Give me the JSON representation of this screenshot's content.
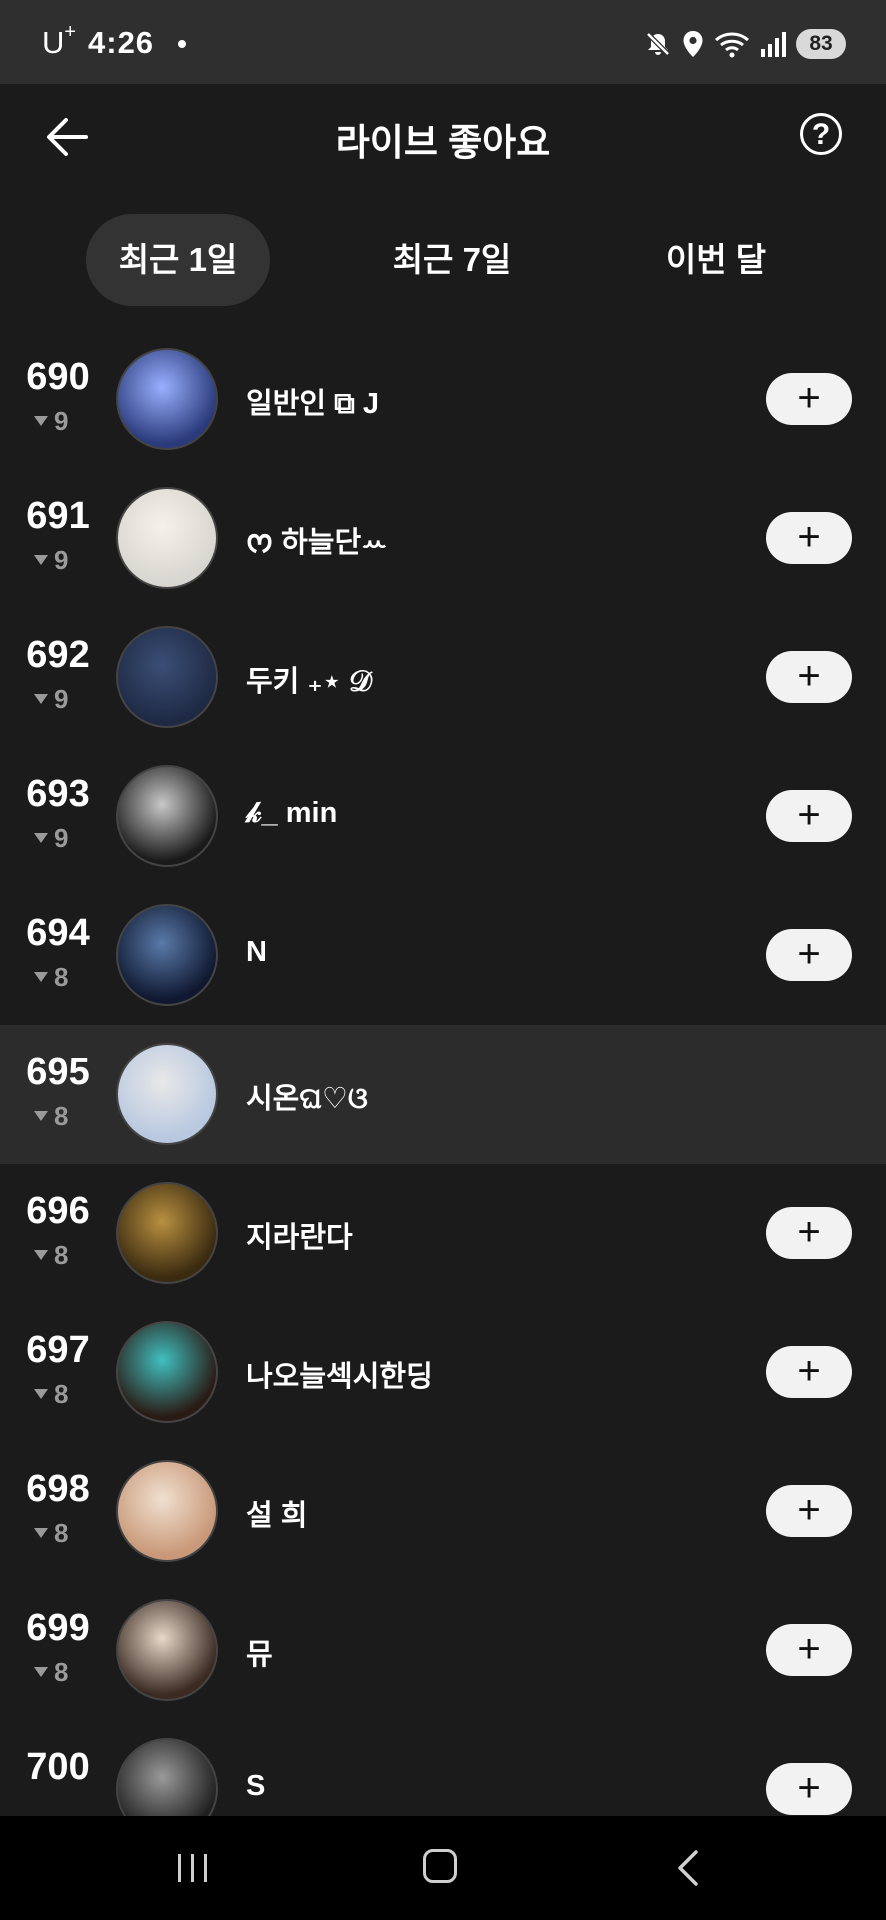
{
  "status_bar": {
    "carrier": "U",
    "carrier_sup": "+",
    "time": "4:26",
    "battery": "83"
  },
  "header": {
    "title": "라이브 좋아요",
    "help_label": "?"
  },
  "tabs": [
    {
      "label": "최근 1일",
      "active": true
    },
    {
      "label": "최근 7일",
      "active": false
    },
    {
      "label": "이번 달",
      "active": false
    }
  ],
  "list": {
    "rows": [
      {
        "rank": "690",
        "change": "9",
        "name": "일반인 ⧉ J",
        "follow": "+",
        "avatar": [
          "#2a3a7a",
          "#9ab0ff"
        ]
      },
      {
        "rank": "691",
        "change": "9",
        "name": "ᰔ 하늘단ꕀ",
        "follow": "+",
        "avatar": [
          "#d8d6d0",
          "#f5f2ea"
        ]
      },
      {
        "rank": "692",
        "change": "9",
        "name": "두키 ₊⋆ 𝒟",
        "follow": "+",
        "avatar": [
          "#1e2a44",
          "#3c4e76"
        ]
      },
      {
        "rank": "693",
        "change": "9",
        "name": "𝓀_ min",
        "follow": "+",
        "avatar": [
          "#1a1a1a",
          "#c8c8c8"
        ]
      },
      {
        "rank": "694",
        "change": "8",
        "name": "N",
        "follow": "+",
        "avatar": [
          "#0f1830",
          "#5a7aa8"
        ]
      },
      {
        "rank": "695",
        "change": "8",
        "name": "시온ଘ♡ଓ",
        "follow": "",
        "avatar": [
          "#b8c8e0",
          "#e8e8e8"
        ],
        "highlight": true
      },
      {
        "rank": "696",
        "change": "8",
        "name": "지라란다",
        "follow": "+",
        "avatar": [
          "#3a2a10",
          "#b89040"
        ]
      },
      {
        "rank": "697",
        "change": "8",
        "name": "나오늘섹시한딩",
        "follow": "+",
        "avatar": [
          "#2a1a14",
          "#40c0c0"
        ]
      },
      {
        "rank": "698",
        "change": "8",
        "name": "설 희",
        "follow": "+",
        "avatar": [
          "#c89878",
          "#f0e0d0"
        ]
      },
      {
        "rank": "699",
        "change": "8",
        "name": "뮤",
        "follow": "+",
        "avatar": [
          "#3a2a22",
          "#e8d8c8"
        ]
      },
      {
        "rank": "700",
        "change": "",
        "name": "S",
        "follow": "+",
        "avatar": [
          "#202020",
          "#9a9a9a"
        ]
      }
    ]
  },
  "colors": {
    "background": "#1b1b1b",
    "status_bar": "#2f2f2f",
    "tab_active_bg": "#333333",
    "highlight_row": "#2c2c2c",
    "follow_button": "#f2f2f2",
    "rank_change": "#9a9a9a"
  },
  "icons": {
    "back": "arrow-left",
    "help": "question-circle",
    "mute": "bell-muted",
    "location": "map-pin",
    "wifi": "wifi",
    "signal": "cellular-signal",
    "nav_recent": "recent-apps",
    "nav_home": "home",
    "nav_back": "chevron-left"
  }
}
